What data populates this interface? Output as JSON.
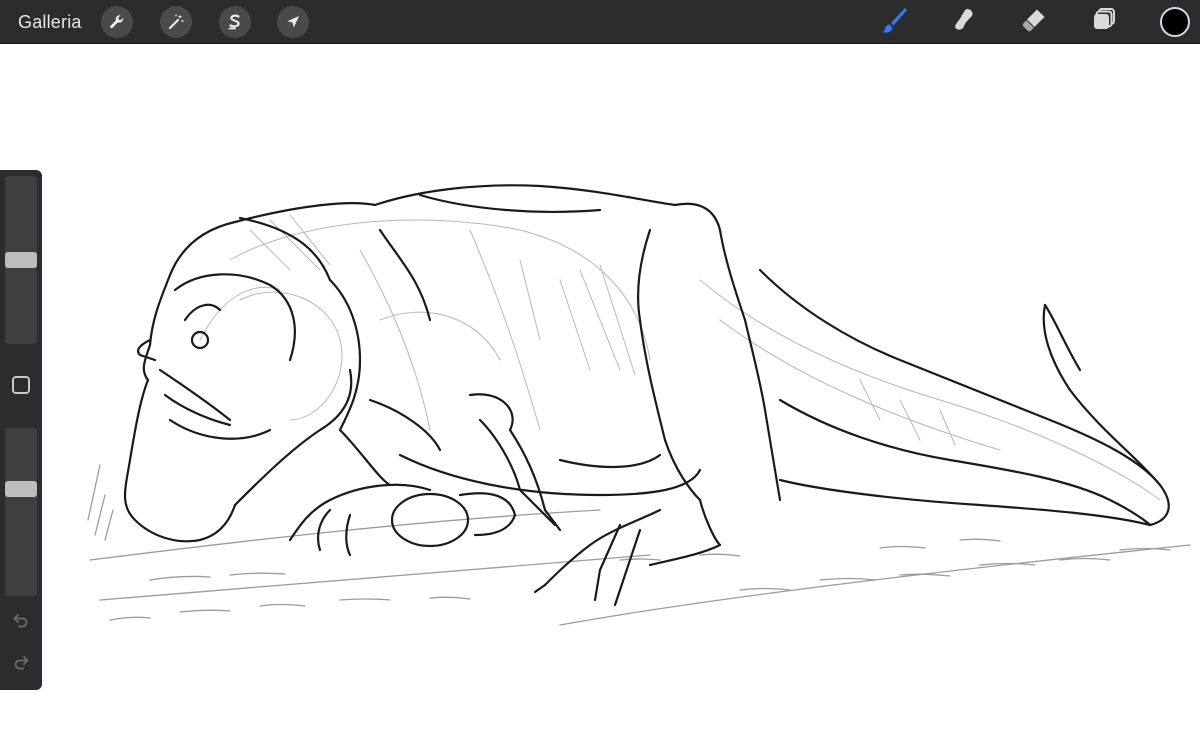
{
  "toolbar": {
    "gallery_label": "Galleria",
    "left_tools": [
      {
        "name": "wrench-icon",
        "action": "actions"
      },
      {
        "name": "magic-wand-icon",
        "action": "adjustments"
      },
      {
        "name": "selection-icon",
        "action": "selection"
      },
      {
        "name": "transform-arrow-icon",
        "action": "transform"
      }
    ],
    "right_tools": [
      {
        "name": "brush-icon",
        "active": true
      },
      {
        "name": "smudge-icon",
        "active": false
      },
      {
        "name": "eraser-icon",
        "active": false
      },
      {
        "name": "layers-icon",
        "active": false
      }
    ],
    "active_color": "#000000",
    "active_tool_color": "#2f7cf6"
  },
  "sidebar": {
    "brush_size": 0.5,
    "brush_opacity": 0.65,
    "icons": [
      "undo-icon",
      "redo-icon"
    ]
  },
  "colors": {
    "toolbar_bg": "#2c2c2e",
    "canvas_bg": "#ffffff",
    "ink": "#1a1a1a"
  }
}
